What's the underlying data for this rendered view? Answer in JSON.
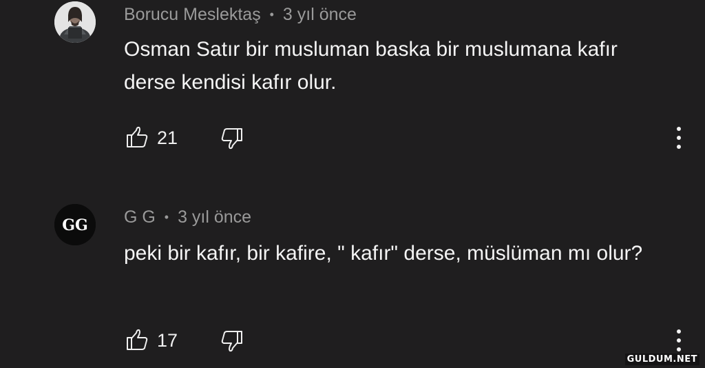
{
  "comments": [
    {
      "author": "Borucu Meslektaş",
      "separator": "•",
      "time": "3 yıl önce",
      "text": "Osman Satır bir musluman baska bir muslumana kafır derse kendisi kafır olur.",
      "likes": "21",
      "avatar_icon": "warrior-portrait"
    },
    {
      "author": "G G",
      "separator": "•",
      "time": "3 yıl önce",
      "text": "peki bir kafır, bir kafire, \" kafır\" derse, müslüman mı olur?",
      "likes": "17",
      "avatar_icon": "gg-monogram",
      "avatar_text": "GG"
    }
  ],
  "icons": {
    "like": "thumbs-up-icon",
    "dislike": "thumbs-down-icon",
    "more": "more-vertical-icon"
  },
  "watermark": "GULDUM.NET",
  "colors": {
    "background": "#1f1e1f",
    "meta_text": "#9a9a9a",
    "body_text": "#f4f4f4"
  }
}
